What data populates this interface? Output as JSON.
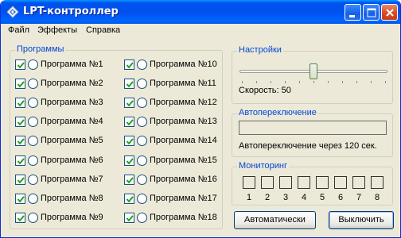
{
  "window": {
    "title": "LPT-контроллер",
    "title_icon": "diamond-arrow-icon",
    "controls": [
      "minimize-icon",
      "maximize-icon",
      "close-icon"
    ]
  },
  "menu": {
    "items": [
      "Файл",
      "Эффекты",
      "Справка"
    ]
  },
  "programs": {
    "title": "Программы",
    "items": [
      {
        "label": "Программа №1",
        "checked": true
      },
      {
        "label": "Программа №2",
        "checked": true
      },
      {
        "label": "Программа №3",
        "checked": true
      },
      {
        "label": "Программа №4",
        "checked": true
      },
      {
        "label": "Программа №5",
        "checked": true
      },
      {
        "label": "Программа №6",
        "checked": true
      },
      {
        "label": "Программа №7",
        "checked": true
      },
      {
        "label": "Программа №8",
        "checked": true
      },
      {
        "label": "Программа №9",
        "checked": true
      },
      {
        "label": "Программа №10",
        "checked": true
      },
      {
        "label": "Программа №11",
        "checked": true
      },
      {
        "label": "Программа №12",
        "checked": true
      },
      {
        "label": "Программа №13",
        "checked": true
      },
      {
        "label": "Программа №14",
        "checked": true
      },
      {
        "label": "Программа №15",
        "checked": true
      },
      {
        "label": "Программа №16",
        "checked": true
      },
      {
        "label": "Программа №17",
        "checked": true
      },
      {
        "label": "Программа №18",
        "checked": true
      }
    ]
  },
  "settings": {
    "title": "Настройки",
    "speed_label": "Скорость: 50",
    "speed_value": 50,
    "speed_min": 0,
    "speed_max": 100
  },
  "autoswitch": {
    "title": "Автопереключение",
    "progress": 0,
    "status": "Автопереключение через 120 сек."
  },
  "monitoring": {
    "title": "Мониторинг",
    "channels": [
      "1",
      "2",
      "3",
      "4",
      "5",
      "6",
      "7",
      "8"
    ]
  },
  "buttons": {
    "auto": "Автоматически",
    "off": "Выключить"
  },
  "colors": {
    "group_title": "#0046d5",
    "checkmark": "#21a121",
    "titlebar": "#0054e3"
  }
}
